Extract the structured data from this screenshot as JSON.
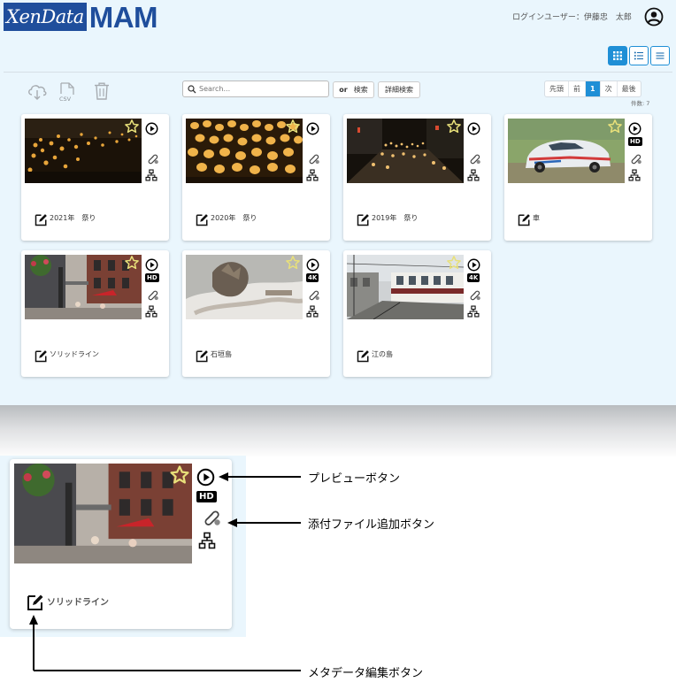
{
  "header": {
    "logo_part1": "XenData",
    "logo_part2": "MAM",
    "login_user_label": "ログインユーザー：伊藤忠　太郎"
  },
  "toolbar": {
    "csv_label": "CSV",
    "search_placeholder": "Search...",
    "or_label": "or",
    "search_button": "検索",
    "advanced_search_button": "詳細検索"
  },
  "pager": {
    "first": "先頭",
    "prev": "前",
    "current": "1",
    "next": "次",
    "last": "最後",
    "count": "件数: 7"
  },
  "cards": [
    {
      "title": "2021年　祭り",
      "badge": ""
    },
    {
      "title": "2020年　祭り",
      "badge": ""
    },
    {
      "title": "2019年　祭り",
      "badge": ""
    },
    {
      "title": "車",
      "badge": "HD"
    },
    {
      "title": "ソリッドライン",
      "badge": "HD"
    },
    {
      "title": "石垣島",
      "badge": "4K"
    },
    {
      "title": "江の島",
      "badge": "4K"
    }
  ],
  "zoom": {
    "title": "ソリッドライン",
    "badge": "HD",
    "preview_label": "プレビューボタン",
    "attach_label": "添付ファイル追加ボタン",
    "meta_edit_label": "メタデータ編集ボタン"
  },
  "colors": {
    "app_background": "#eaf6fd",
    "brand_blue": "#1f4e9c",
    "accent_blue": "#1f8fd6",
    "star_yellow": "#e8e07a"
  }
}
